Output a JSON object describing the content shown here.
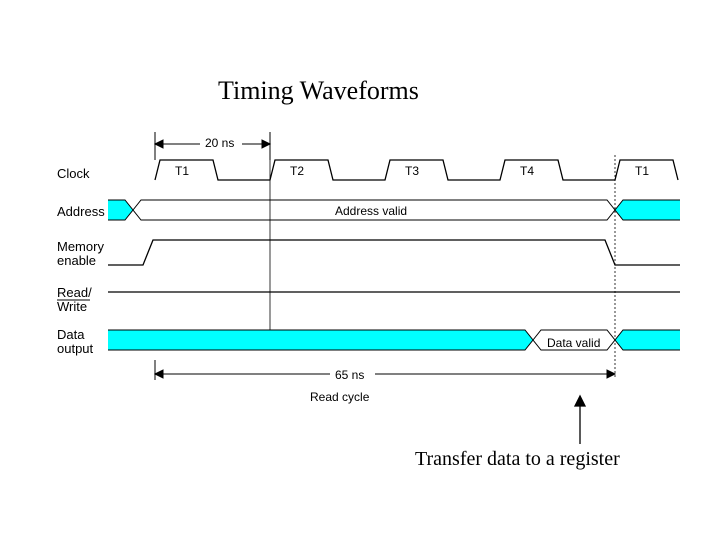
{
  "title": "Timing Waveforms",
  "signals": {
    "clock": "Clock",
    "address": "Address",
    "memory": "Memory\nenable",
    "rw": "Read/\nWrite",
    "data": "Data\noutput"
  },
  "labels": {
    "period": "20 ns",
    "T1": "T1",
    "T2": "T2",
    "T3": "T3",
    "T4": "T4",
    "T1b": "T1",
    "addr_valid": "Address valid",
    "data_valid": "Data valid",
    "readcycle_time": "65 ns",
    "readcycle": "Read cycle"
  },
  "caption": "Transfer data to a register",
  "chart_data": {
    "type": "timing-diagram",
    "title": "Timing Waveforms",
    "clock_period_ns": 20,
    "read_cycle_ns": 65,
    "cycles": [
      "T1",
      "T2",
      "T3",
      "T4",
      "T1"
    ],
    "signals": [
      {
        "name": "Clock",
        "type": "clock",
        "period_ns": 20
      },
      {
        "name": "Address",
        "type": "bus",
        "valid_range_cycles": [
          0,
          4
        ],
        "valid_label": "Address valid"
      },
      {
        "name": "Memory enable",
        "type": "level",
        "high_range_cycles": [
          0,
          4
        ]
      },
      {
        "name": "Read/Write",
        "type": "level",
        "state": "read",
        "held_high": true
      },
      {
        "name": "Data output",
        "type": "bus",
        "valid_range_cycles": [
          3.25,
          4
        ],
        "valid_label": "Data valid"
      }
    ],
    "event": "Transfer data to a register at end of T4"
  }
}
